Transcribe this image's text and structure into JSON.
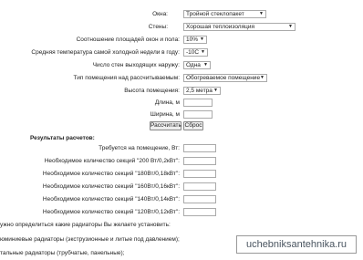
{
  "form": {
    "rows": [
      {
        "label": "Окна:",
        "value": "Тройной стеклопакет"
      },
      {
        "label": "Стены:",
        "value": "Хорошая теплоизоляция"
      },
      {
        "label": "Соотношение площадей окон и пола:",
        "value": "10%"
      },
      {
        "label": "Средняя температура самой холодной недели в году:",
        "value": "-10С"
      },
      {
        "label": "Число стен выходящих наружу:",
        "value": "Одна"
      },
      {
        "label": "Тип помещения над рассчитываемым:",
        "value": "Обогреваемое помещение"
      },
      {
        "label": "Высота помещения:",
        "value": "2,5 метра"
      }
    ],
    "length_label": "Длина, м",
    "length_value": "",
    "width_label": "Ширина, м",
    "width_value": "",
    "calculate_label": "Рассчитать",
    "reset_label": "Сброс"
  },
  "results": {
    "heading": "Результаты расчетов:",
    "items": [
      {
        "label": "Требуется на помещение, Вт:",
        "value": ""
      },
      {
        "label": "Необходимое количество секций \"200 Вт/0,2кВт\":",
        "value": ""
      },
      {
        "label": "Необходимое количество секций \"180Вт/0,18кВт\":",
        "value": ""
      },
      {
        "label": "Необходимое количество секций \"160Вт/0,16кВт\":",
        "value": ""
      },
      {
        "label": "Необходимое количество секций \"140Вт/0,14кВт\":",
        "value": ""
      },
      {
        "label": "Необходимое количество секций \"120Вт/0,12кВт\":",
        "value": ""
      }
    ]
  },
  "notes": [
    "ужно определиться какие радиаторы Вы желаете установить:",
    "юминиевые радиаторы (экструзионные и литые под давлением);",
    "тальные радиаторы (трубчатые, панельные);"
  ],
  "watermark": "uchebniksantehnika.ru"
}
